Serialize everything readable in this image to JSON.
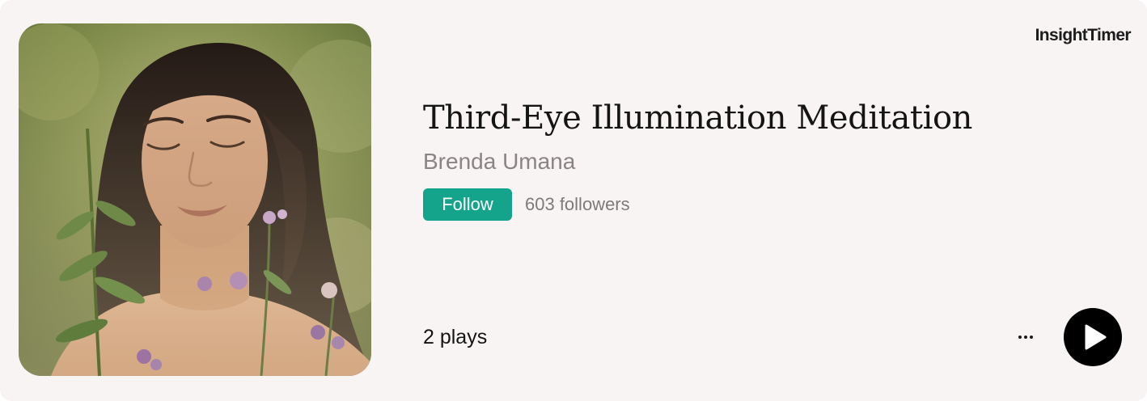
{
  "brand": {
    "name": "InsightTimer"
  },
  "track": {
    "title": "Third-Eye Illumination Meditation",
    "author": "Brenda Umana",
    "follow_label": "Follow",
    "followers": "603 followers",
    "plays": "2 plays"
  },
  "controls": {
    "more_icon": "more-horizontal-icon",
    "play_icon": "play-icon"
  },
  "colors": {
    "background": "#f8f4f3",
    "accent": "#14a38b",
    "play_button": "#000000",
    "title_text": "#141414",
    "secondary_text": "#8a8584"
  }
}
